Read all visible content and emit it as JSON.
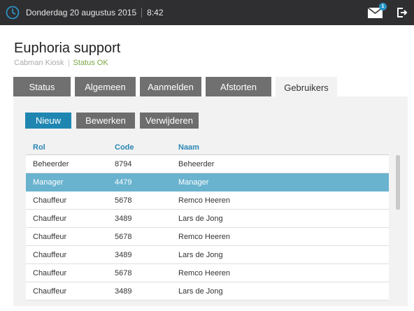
{
  "topbar": {
    "date": "Donderdag 20 augustus 2015",
    "time": "8:42",
    "mail_badge": "1",
    "clock_icon": "clock-icon",
    "mail_icon": "mail-icon",
    "logout_icon": "logout-icon"
  },
  "header": {
    "title": "Euphoria support",
    "subtitle_app": "Cabman Kiosk",
    "subtitle_status": "Status OK"
  },
  "tabs": [
    {
      "label": "Status"
    },
    {
      "label": "Algemeen"
    },
    {
      "label": "Aanmelden"
    },
    {
      "label": "Afstorten"
    },
    {
      "label": "Gebruikers"
    }
  ],
  "active_tab": "Gebruikers",
  "actions": {
    "new_label": "Nieuw",
    "edit_label": "Bewerken",
    "delete_label": "Verwijderen"
  },
  "table": {
    "columns": [
      "Rol",
      "Code",
      "Naam"
    ],
    "rows": [
      {
        "rol": "Beheerder",
        "code": "8794",
        "naam": "Beheerder"
      },
      {
        "rol": "Manager",
        "code": "4479",
        "naam": "Manager"
      },
      {
        "rol": "Chauffeur",
        "code": "5678",
        "naam": "Remco Heeren"
      },
      {
        "rol": "Chauffeur",
        "code": "3489",
        "naam": "Lars de Jong"
      },
      {
        "rol": "Chauffeur",
        "code": "5678",
        "naam": "Remco Heeren"
      },
      {
        "rol": "Chauffeur",
        "code": "3489",
        "naam": "Lars de Jong"
      },
      {
        "rol": "Chauffeur",
        "code": "5678",
        "naam": "Remco Heeren"
      },
      {
        "rol": "Chauffeur",
        "code": "3489",
        "naam": "Lars de Jong"
      }
    ],
    "selected_row": 1
  },
  "colors": {
    "accent": "#1f86b2",
    "selected_row": "#69b3cf",
    "status_ok": "#7aa545",
    "topbar": "#2f2f31"
  }
}
